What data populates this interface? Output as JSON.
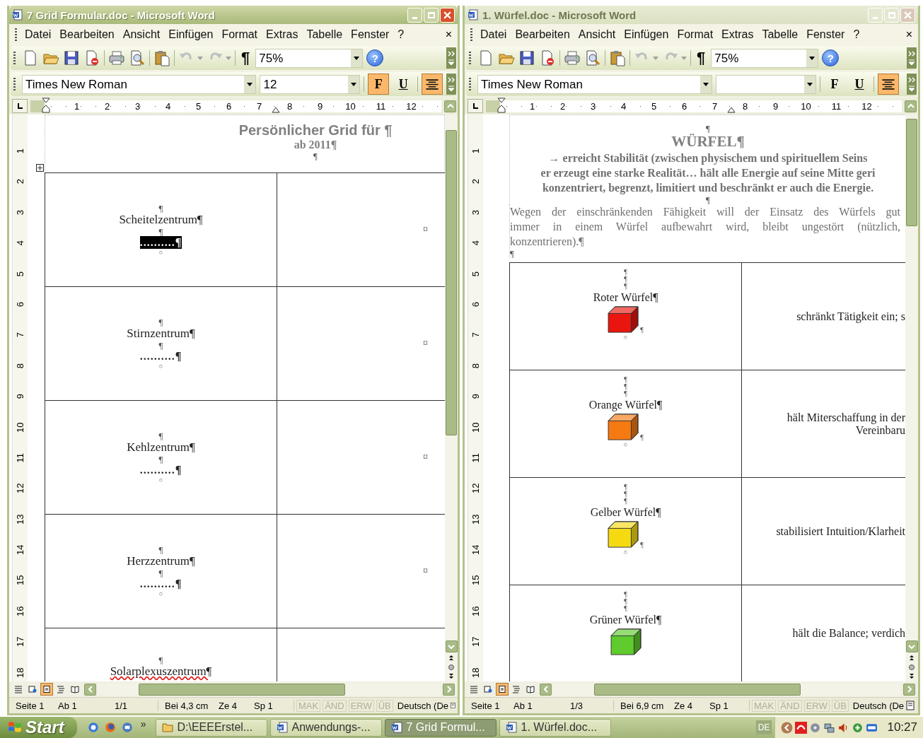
{
  "windows": [
    {
      "title": "7 Grid Formular.doc - Microsoft Word",
      "active": true,
      "menu": [
        "Datei",
        "Bearbeiten",
        "Ansicht",
        "Einfügen",
        "Format",
        "Extras",
        "Tabelle",
        "Fenster",
        "?"
      ],
      "menu_close": "×",
      "toolbar": [
        [
          {
            "kind": "new",
            "disabled": false
          },
          {
            "kind": "open",
            "disabled": false
          },
          {
            "kind": "save",
            "disabled": false
          },
          {
            "kind": "permission",
            "disabled": false
          }
        ],
        [
          {
            "kind": "print",
            "disabled": false
          },
          {
            "kind": "preview",
            "disabled": false
          }
        ],
        [
          {
            "kind": "paste",
            "disabled": false
          }
        ],
        [
          {
            "kind": "undo",
            "disabled": true
          },
          {
            "kind": "redo",
            "disabled": true
          }
        ]
      ],
      "pilcrow": "¶",
      "zoom": "75%",
      "help": "?",
      "font": "Times New Roman",
      "size": "12",
      "format_buttons": [
        {
          "kind": "bold",
          "label": "F",
          "selected": true
        },
        {
          "kind": "underline",
          "label": "U",
          "selected": false
        },
        {
          "kind": "center",
          "selected": true
        }
      ],
      "ruler": {
        "horizontal": [
          "1",
          "2",
          "3",
          "4",
          "5",
          "6",
          "7",
          "8",
          "9",
          "10",
          "11",
          "12"
        ],
        "vertical": [
          "1",
          "2",
          "3",
          "4",
          "5",
          "6",
          "7",
          "8",
          "9",
          "10",
          "11",
          "12",
          "13",
          "14",
          "15",
          "16",
          "17",
          "18"
        ]
      },
      "document": {
        "kind": "grid-form",
        "heading": "Persönlicher Grid für ¶",
        "subheading": "ab 2011¶",
        "after": "¶",
        "rows": [
          {
            "mark": "¶",
            "label": "Scheitelzentrum¶",
            "spelling_error": false,
            "mark_below": "¶",
            "field": "..........¶",
            "field_selected": true,
            "end": "○",
            "right": "¤"
          },
          {
            "mark": "¶",
            "label": "Stirnzentrum¶",
            "spelling_error": false,
            "mark_below": "¶",
            "field": "..........¶",
            "field_selected": false,
            "end": "○",
            "right": "¤"
          },
          {
            "mark": "¶",
            "label": "Kehlzentrum¶",
            "spelling_error": false,
            "mark_below": "¶",
            "field": "..........¶",
            "field_selected": false,
            "end": "○",
            "right": "¤"
          },
          {
            "mark": "¶",
            "label": "Herzzentrum¶",
            "spelling_error": false,
            "mark_below": "¶",
            "field": "..........¶",
            "field_selected": false,
            "end": "○",
            "right": "¤"
          },
          {
            "mark": "¶",
            "label": "Solarplexuszentrum¶",
            "spelling_error": true
          }
        ]
      },
      "view_buttons": [
        {
          "kind": "normal",
          "selected": false
        },
        {
          "kind": "web",
          "selected": false
        },
        {
          "kind": "print",
          "selected": true
        },
        {
          "kind": "outline",
          "selected": false
        },
        {
          "kind": "reading",
          "selected": false
        }
      ],
      "status": {
        "fields": [
          [
            "Seite 1",
            "Ab 1",
            "1/1"
          ],
          [
            "Bei 4,3 cm",
            "Ze 4",
            "Sp 1"
          ]
        ],
        "modes": [
          {
            "label": "MAK",
            "disabled": true
          },
          {
            "label": "ÄND",
            "disabled": true
          },
          {
            "label": "ERW",
            "disabled": true
          },
          {
            "label": "ÜB",
            "disabled": true
          }
        ],
        "language": "Deutsch (De"
      }
    },
    {
      "title": "1. Würfel.doc - Microsoft Word",
      "active": false,
      "menu": [
        "Datei",
        "Bearbeiten",
        "Ansicht",
        "Einfügen",
        "Format",
        "Extras",
        "Tabelle",
        "Fenster",
        "?"
      ],
      "menu_close": "×",
      "toolbar": [
        [
          {
            "kind": "new",
            "disabled": false
          },
          {
            "kind": "open",
            "disabled": false
          },
          {
            "kind": "save",
            "disabled": false
          },
          {
            "kind": "permission",
            "disabled": false
          }
        ],
        [
          {
            "kind": "print",
            "disabled": false
          },
          {
            "kind": "preview",
            "disabled": false
          }
        ],
        [
          {
            "kind": "paste",
            "disabled": false
          }
        ],
        [
          {
            "kind": "undo",
            "disabled": true
          },
          {
            "kind": "redo",
            "disabled": true
          }
        ]
      ],
      "pilcrow": "¶",
      "zoom": "75%",
      "help": "?",
      "font": "Times New Roman",
      "format_buttons": [
        {
          "kind": "bold",
          "label": "F",
          "selected": false
        },
        {
          "kind": "underline",
          "label": "U",
          "selected": false
        },
        {
          "kind": "center",
          "selected": true
        }
      ],
      "ruler": {
        "horizontal": [
          "1",
          "2",
          "3",
          "4",
          "5",
          "6",
          "7",
          "8",
          "9",
          "10",
          "11",
          "12"
        ],
        "vertical": [
          "1",
          "2",
          "3",
          "4",
          "5",
          "6",
          "7",
          "8",
          "9",
          "10",
          "11",
          "12",
          "13",
          "14",
          "15",
          "16",
          "17",
          "18"
        ]
      },
      "document": {
        "kind": "cube-doc",
        "top_mark": "¶",
        "heading": "WÜRFEL¶",
        "intro_lines": [
          "→ erreicht Stabilität (zwischen physischem und spirituellem Seins",
          "er erzeugt eine starke Realität… hält alle Energie auf seine Mitte geri",
          "konzentriert, begrenzt, limitiert und beschränkt er auch die Energie."
        ],
        "mid_mark": "¶",
        "body_lines": [
          "Wegen der einschränkenden Fähigkeit will der Einsatz des Würfels gut",
          "immer in einem Würfel aufbewahrt wird, bleibt ungestört (nützlich,",
          "konzentrieren).¶"
        ],
        "end_mark": "¶",
        "rows": [
          {
            "marks": [
              "¶",
              "¶",
              "¶"
            ],
            "label": "Roter Würfel¶",
            "color": "#e8160f",
            "cube_mark": "¶",
            "end": "○",
            "text_lines": [
              "schränkt Tätigkeit ein; s"
            ]
          },
          {
            "marks": [
              "¶",
              "¶",
              "¶"
            ],
            "label": "Orange Würfel¶",
            "color": "#f57a12",
            "cube_mark": "¶",
            "end": "○",
            "text_lines": [
              "hält Miterschaffung in der",
              "Vereinbaru"
            ]
          },
          {
            "marks": [
              "¶",
              "¶",
              "¶"
            ],
            "label": "Gelber Würfel¶",
            "color": "#f5da12",
            "cube_mark": "¶",
            "end": "○",
            "text_lines": [
              "stabilisiert Intuition/Klarheit"
            ]
          },
          {
            "marks": [
              "¶",
              "¶",
              "¶"
            ],
            "label": "Grüner Würfel¶",
            "color": "#5fcb2c",
            "text_lines": [
              "hält die Balance; verdich"
            ]
          }
        ]
      },
      "view_buttons": [
        {
          "kind": "normal",
          "selected": false
        },
        {
          "kind": "web",
          "selected": false
        },
        {
          "kind": "print",
          "selected": true
        },
        {
          "kind": "outline",
          "selected": false
        },
        {
          "kind": "reading",
          "selected": false
        }
      ],
      "status": {
        "fields": [
          [
            "Seite 1",
            "Ab 1",
            "1/3"
          ],
          [
            "Bei 6,9 cm",
            "Ze 4",
            "Sp 1"
          ]
        ],
        "modes": [
          {
            "label": "MAK",
            "disabled": true
          },
          {
            "label": "ÄND",
            "disabled": true
          },
          {
            "label": "ERW",
            "disabled": true
          },
          {
            "label": "ÜB",
            "disabled": true
          }
        ],
        "language": "Deutsch (De"
      }
    }
  ],
  "taskbar": {
    "start": "Start",
    "more": "»",
    "tasks": [
      {
        "kind": "folder",
        "label": "D:\\EEEErstel...",
        "selected": false
      },
      {
        "kind": "word",
        "label": "Anwendungs-...",
        "selected": false
      },
      {
        "kind": "word",
        "label": "7 Grid Formul...",
        "selected": true
      },
      {
        "kind": "word",
        "label": "1. Würfel.doc...",
        "selected": false
      }
    ],
    "language": "DE",
    "time": "10:27"
  }
}
